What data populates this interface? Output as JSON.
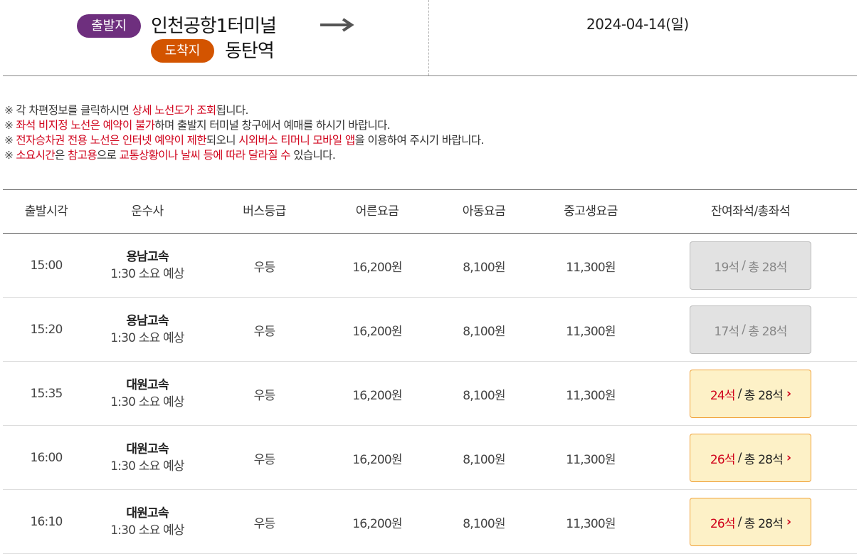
{
  "route": {
    "departure_badge": "출발지",
    "departure": "인천공항1터미널",
    "arrival_badge": "도착지",
    "arrival": "동탄역",
    "date": "2024-04-14(일)"
  },
  "notices": {
    "mark": "※",
    "line1": [
      "각 차편정보를 클릭하시면 ",
      "상세 노선도가 조회",
      "됩니다."
    ],
    "line2": [
      "좌석 비지정 노선은 예약이 불가",
      "하며 출발지 터미널 창구에서 예매를 하시기 바랍니다."
    ],
    "line3": [
      "전자승차권 전용 노선은 인터넷 예약이 제한",
      "되오니 ",
      "시외버스 티머니 모바일 앱",
      "을 이용하여 주시기 바랍니다."
    ],
    "line4": [
      "소요시간",
      "은 ",
      "참고용",
      "으로 ",
      "교통상황이나 날씨 등에 따라 달라질 수",
      " 있습니다."
    ]
  },
  "table": {
    "headers": [
      "출발시각",
      "운수사",
      "버스등급",
      "어른요금",
      "아동요금",
      "중고생요금",
      "잔여좌석/총좌석"
    ],
    "rows": [
      {
        "time": "15:00",
        "operator": "용남고속",
        "duration": "1:30 소요 예상",
        "grade": "우등",
        "adult": "16,200원",
        "child": "8,100원",
        "student": "11,300원",
        "remaining": "19석",
        "total": "총 28석",
        "available": false
      },
      {
        "time": "15:20",
        "operator": "용남고속",
        "duration": "1:30 소요 예상",
        "grade": "우등",
        "adult": "16,200원",
        "child": "8,100원",
        "student": "11,300원",
        "remaining": "17석",
        "total": "총 28석",
        "available": false
      },
      {
        "time": "15:35",
        "operator": "대원고속",
        "duration": "1:30 소요 예상",
        "grade": "우등",
        "adult": "16,200원",
        "child": "8,100원",
        "student": "11,300원",
        "remaining": "24석",
        "total": "총 28석",
        "available": true
      },
      {
        "time": "16:00",
        "operator": "대원고속",
        "duration": "1:30 소요 예상",
        "grade": "우등",
        "adult": "16,200원",
        "child": "8,100원",
        "student": "11,300원",
        "remaining": "26석",
        "total": "총 28석",
        "available": true
      },
      {
        "time": "16:10",
        "operator": "대원고속",
        "duration": "1:30 소요 예상",
        "grade": "우등",
        "adult": "16,200원",
        "child": "8,100원",
        "student": "11,300원",
        "remaining": "26석",
        "total": "총 28석",
        "available": true
      }
    ],
    "seat_separator": "/",
    "chevron": "›"
  },
  "colors": {
    "departure_badge": "#6e2f7e",
    "arrival_badge": "#d35400",
    "highlight": "#d0021b",
    "available_bg": "#fdf1c7",
    "available_border": "#f0a23a",
    "disabled_bg": "#e2e2e2"
  },
  "icons": {
    "route_arrow": "arrow-right-icon",
    "select": "chevron-right-icon"
  }
}
